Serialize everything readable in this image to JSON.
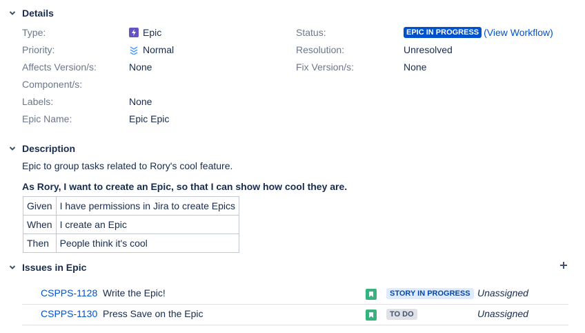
{
  "details": {
    "title": "Details",
    "left_fields": [
      {
        "label": "Type:",
        "value": "Epic",
        "icon": "epic-icon"
      },
      {
        "label": "Priority:",
        "value": "Normal",
        "icon": "priority-normal-icon"
      },
      {
        "label": "Affects Version/s:",
        "value": "None"
      },
      {
        "label": "Component/s:",
        "value": ""
      },
      {
        "label": "Labels:",
        "value": "None"
      },
      {
        "label": "Epic Name:",
        "value": "Epic Epic"
      }
    ],
    "right_fields": [
      {
        "label": "Status:",
        "value": "EPIC IN PROGRESS",
        "link": "(View Workflow)"
      },
      {
        "label": "Resolution:",
        "value": "Unresolved"
      },
      {
        "label": "Fix Version/s:",
        "value": "None"
      }
    ]
  },
  "description": {
    "title": "Description",
    "text": "Epic to group tasks related to Rory's cool feature.",
    "story": "As Rory, I want to create an Epic, so that I can show how cool they are.",
    "table": [
      [
        "Given",
        "I have permissions in Jira to create Epics"
      ],
      [
        "When",
        "I create an Epic"
      ],
      [
        "Then",
        "People think it's cool"
      ]
    ]
  },
  "issues_in_epic": {
    "title": "Issues in Epic",
    "issues": [
      {
        "key": "CSPPS-1128",
        "summary": "Write the Epic!",
        "status": "STORY IN PROGRESS",
        "status_bg": "#deebff",
        "status_color": "#0747a6",
        "assignee": "Unassigned"
      },
      {
        "key": "CSPPS-1130",
        "summary": "Press Save on the Epic",
        "status": "TO DO",
        "status_bg": "#dfe1e6",
        "status_color": "#42526e",
        "assignee": "Unassigned"
      }
    ]
  },
  "colors": {
    "link": "#0052cc",
    "status_epic_bg": "#0052cc",
    "story_icon": "#36b37e",
    "epic_icon": "#6554c0",
    "label_grey": "#6b778c"
  }
}
